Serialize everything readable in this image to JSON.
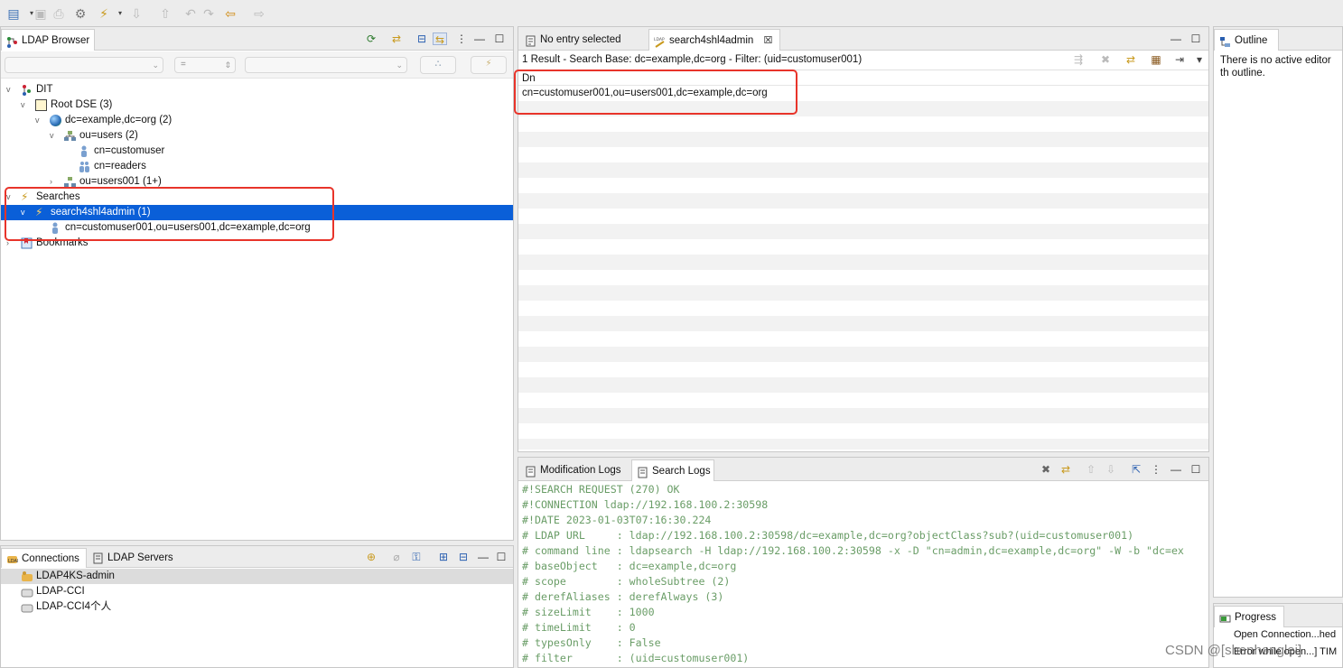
{
  "toolbar": {
    "icons": [
      "new-icon",
      "save-icon",
      "print-icon",
      "preferences-icon",
      "connect-icon",
      "import-icon",
      "export-icon",
      "back-history-icon",
      "forward-history-icon",
      "back-icon",
      "forward-icon"
    ]
  },
  "ldap_browser": {
    "tab_label": "LDAP Browser",
    "filter_equals": "=",
    "tree": {
      "dit": "DIT",
      "root_dse": "Root DSE (3)",
      "base": "dc=example,dc=org (2)",
      "ou_users": "ou=users (2)",
      "cn_customuser": "cn=customuser",
      "cn_readers": "cn=readers",
      "ou_users001": "ou=users001 (1+)",
      "searches": "Searches",
      "search_item": "search4shl4admin (1)",
      "search_result": "cn=customuser001,ou=users001,dc=example,dc=org",
      "bookmarks": "Bookmarks"
    }
  },
  "editor": {
    "tab_no_entry": "No entry selected",
    "tab_search": "search4shl4admin",
    "summary": "1 Result  -  Search Base: dc=example,dc=org  -  Filter: (uid=customuser001)",
    "column_header": "Dn",
    "rows": [
      "cn=customuser001,ou=users001,dc=example,dc=org"
    ]
  },
  "outline": {
    "tab_label": "Outline",
    "message": "There is no active editor th outline."
  },
  "connections": {
    "tab_connections": "Connections",
    "tab_servers": "LDAP Servers",
    "items": [
      "LDAP4KS-admin",
      "LDAP-CCI",
      "LDAP-CCI4个人"
    ]
  },
  "logs": {
    "tab_modification": "Modification Logs",
    "tab_search": "Search Logs",
    "lines": [
      "#!SEARCH REQUEST (270) OK",
      "#!CONNECTION ldap://192.168.100.2:30598",
      "#!DATE 2023-01-03T07:16:30.224",
      "# LDAP URL     : ldap://192.168.100.2:30598/dc=example,dc=org?objectClass?sub?(uid=customuser001)",
      "# command line : ldapsearch -H ldap://192.168.100.2:30598 -x -D \"cn=admin,dc=example,dc=org\" -W -b \"dc=ex",
      "# baseObject   : dc=example,dc=org",
      "# scope        : wholeSubtree (2)",
      "# derefAliases : derefAlways (3)",
      "# sizeLimit    : 1000",
      "# timeLimit    : 0",
      "# typesOnly    : False",
      "# filter       : (uid=customuser001)"
    ]
  },
  "progress": {
    "tab_label": "Progress",
    "items": [
      "Open Connection...hed",
      "Error while open...] TIM"
    ]
  },
  "watermark": "CSDN @[shenhonglei]",
  "colors": {
    "selection": "#0a5fd8",
    "highlight": "#e8342a",
    "log_text": "#6a9d67"
  }
}
